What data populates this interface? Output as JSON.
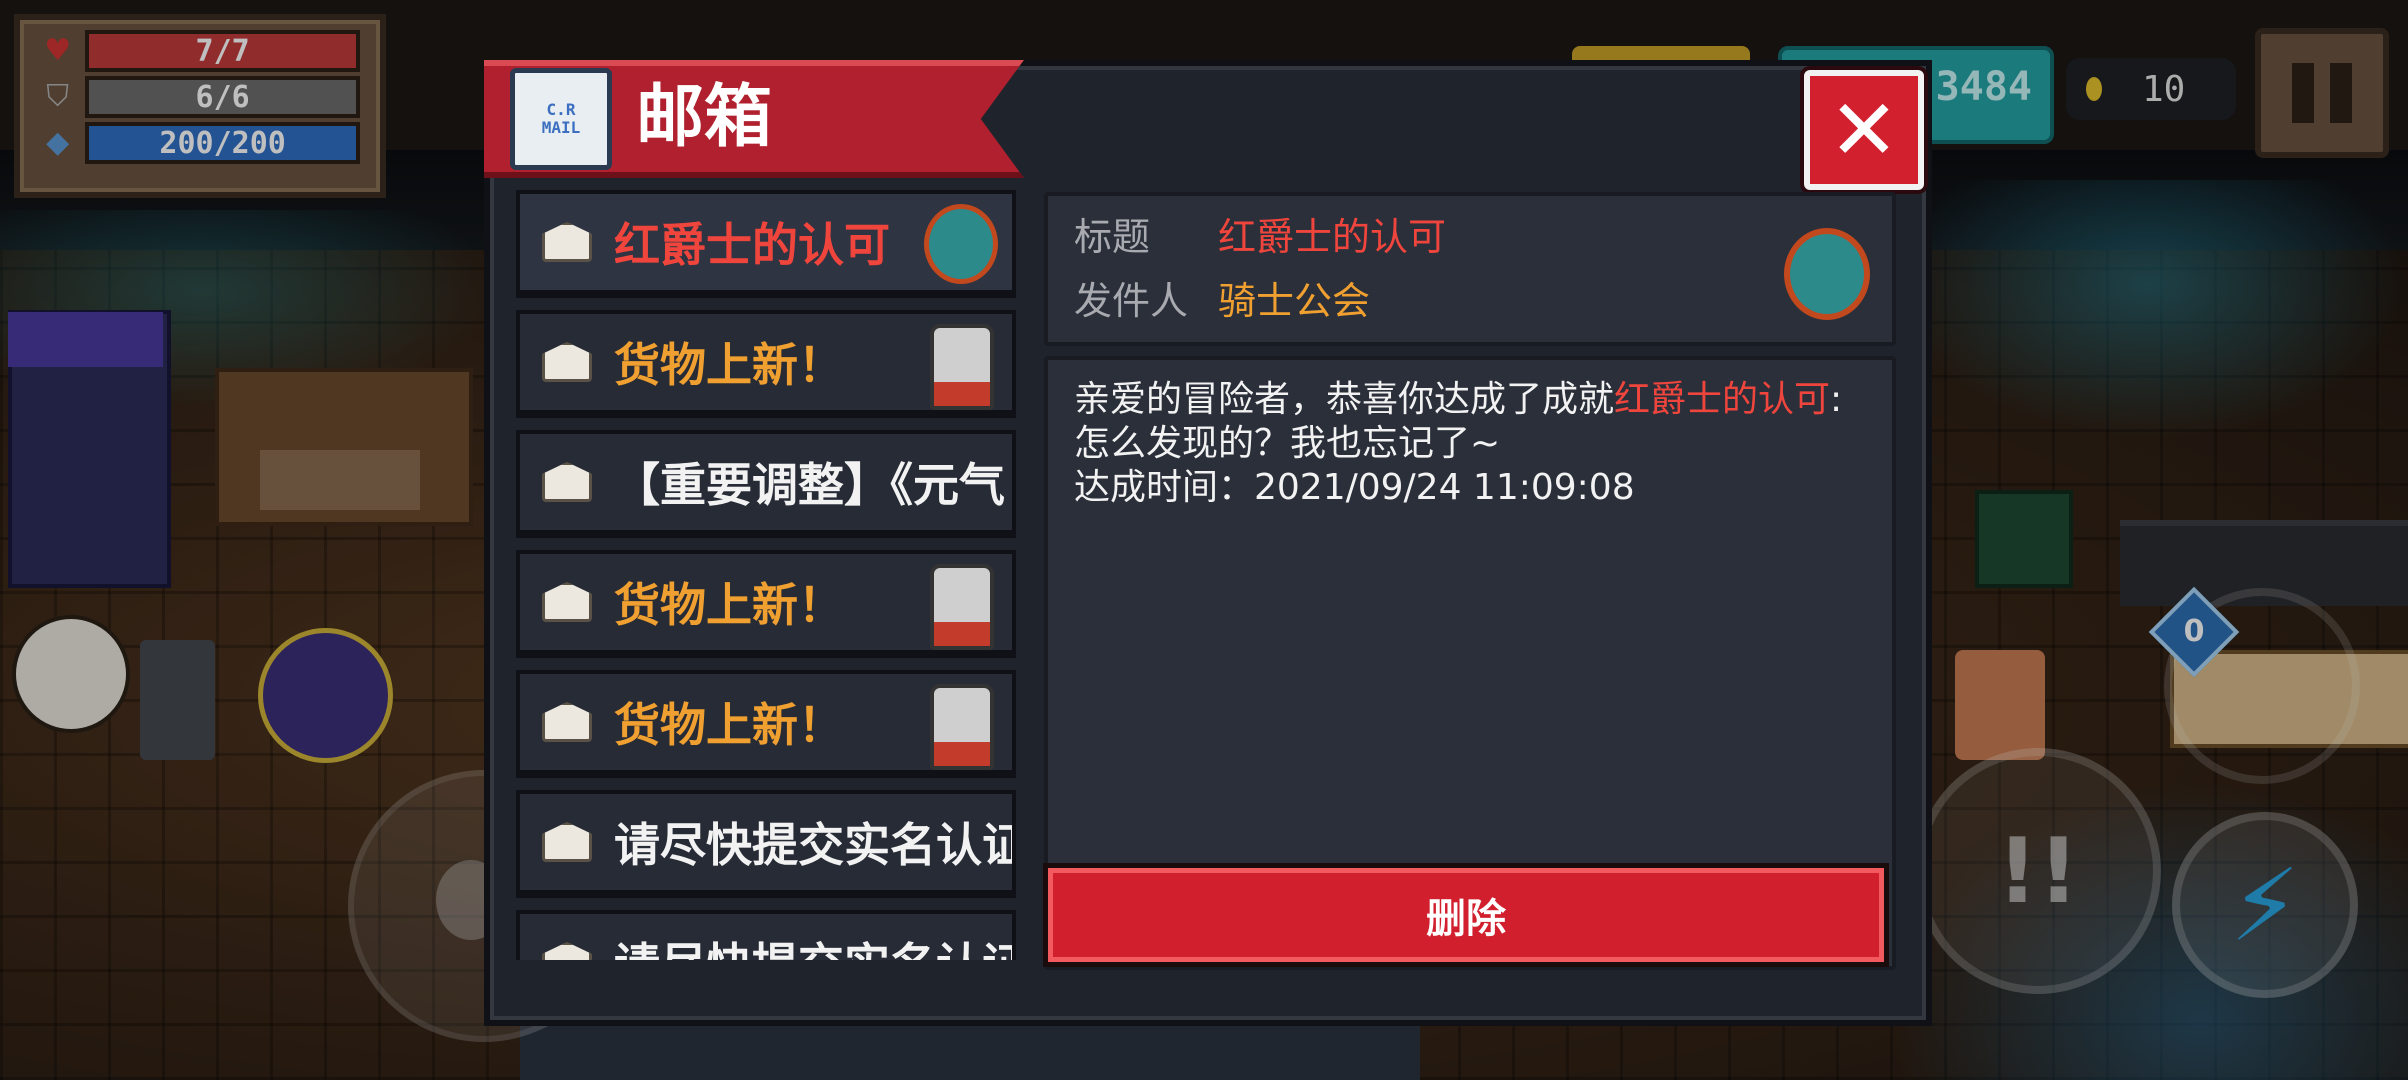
{
  "hud": {
    "hp": "7/7",
    "armor": "6/6",
    "energy": "200/200",
    "gems": "3484",
    "coins": "10",
    "skill_glyph": "!!",
    "attack_glyph": "⚡",
    "weapon_badge": "0"
  },
  "mailbox": {
    "title": "邮箱",
    "icon_text_line1": "C.R",
    "icon_text_line2": "MAIL",
    "close_glyph": "✕",
    "items": [
      {
        "label": "红爵士的认可",
        "color": "red",
        "avatar": "knight-avatar"
      },
      {
        "label": "货物上新！",
        "color": "orange",
        "avatar": "merchant-avatar"
      },
      {
        "label": "【重要调整】《元气",
        "color": "white",
        "avatar": ""
      },
      {
        "label": "货物上新！",
        "color": "orange",
        "avatar": "merchant-avatar"
      },
      {
        "label": "货物上新！",
        "color": "orange",
        "avatar": "merchant-avatar"
      },
      {
        "label": "请尽快提交实名认证",
        "color": "white",
        "avatar": ""
      },
      {
        "label": "请尽快提交实名认证",
        "color": "white",
        "avatar": ""
      }
    ],
    "selected": {
      "title_label": "标题",
      "title_value": "红爵士的认可",
      "sender_label": "发件人",
      "sender_value": "骑士公会",
      "body_prefix": "亲爱的冒险者，恭喜你达成了成就",
      "body_highlight": "红爵士的认可",
      "body_suffix": ":怎么发现的？我也忘记了~",
      "body_time": "达成时间：2021/09/24 11:09:08"
    },
    "delete_label": "删除"
  },
  "colors": {
    "accent_red": "#d11f2d",
    "text_red": "#f0453d",
    "text_orange": "#f0a030",
    "panel_bg": "#1f232c"
  }
}
